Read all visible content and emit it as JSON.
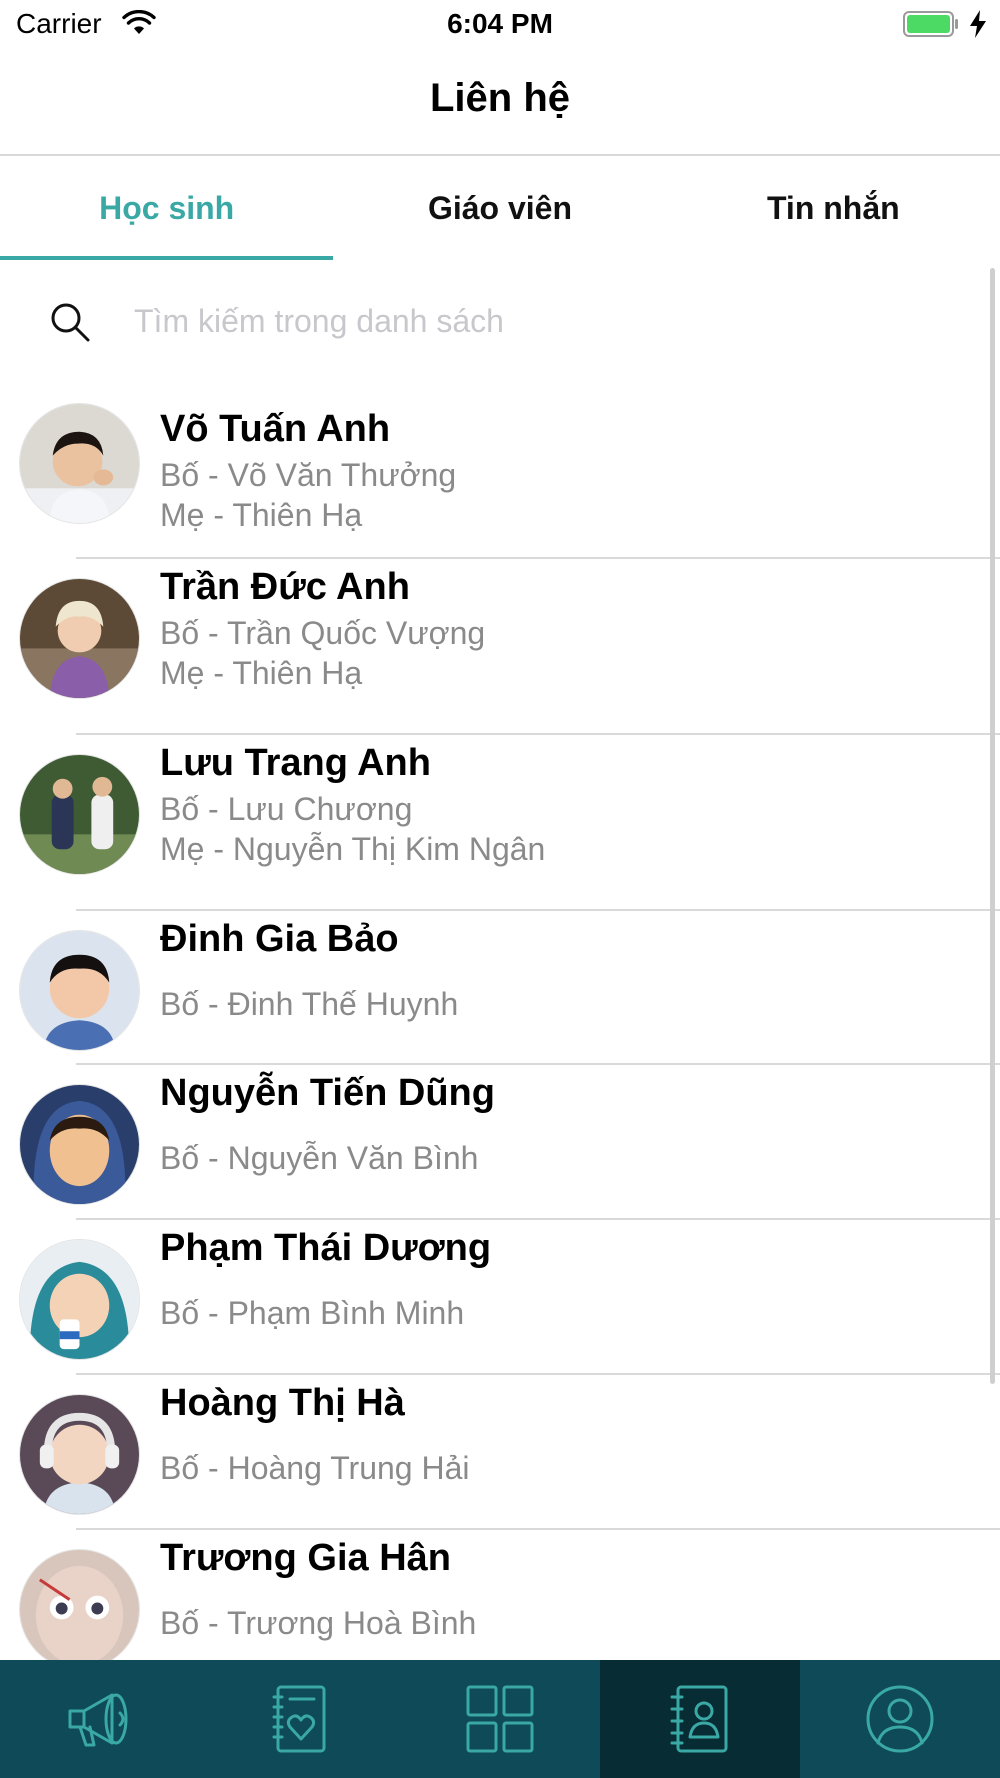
{
  "status_bar": {
    "carrier": "Carrier",
    "time": "6:04 PM"
  },
  "nav": {
    "title": "Liên hệ"
  },
  "tabs": [
    {
      "label": "Học sinh",
      "active": true
    },
    {
      "label": "Giáo viên",
      "active": false
    },
    {
      "label": "Tin nhắn",
      "active": false
    }
  ],
  "search": {
    "placeholder": "Tìm kiếm trong danh sách",
    "value": ""
  },
  "contacts": [
    {
      "name": "Võ Tuấn Anh",
      "parents": [
        "Bố - Võ Văn Thưởng",
        "Mẹ - Thiên Hạ"
      ]
    },
    {
      "name": "Trần Đức Anh",
      "parents": [
        "Bố - Trần Quốc Vượng",
        "Mẹ - Thiên Hạ"
      ]
    },
    {
      "name": "Lưu Trang Anh",
      "parents": [
        "Bố - Lưu Chương",
        "Mẹ - Nguyễn Thị Kim Ngân"
      ]
    },
    {
      "name": "Đinh Gia Bảo",
      "parents": [
        "Bố - Đinh Thế Huynh"
      ]
    },
    {
      "name": "Nguyễn Tiến Dũng",
      "parents": [
        "Bố - Nguyễn Văn Bình"
      ]
    },
    {
      "name": "Phạm Thái Dương",
      "parents": [
        "Bố - Phạm Bình Minh"
      ]
    },
    {
      "name": "Hoàng Thị Hà",
      "parents": [
        "Bố - Hoàng Trung Hải"
      ]
    },
    {
      "name": "Trương Gia Hân",
      "parents": [
        "Bố - Trương Hoà Bình"
      ]
    }
  ],
  "bottom_tabs": [
    {
      "icon": "megaphone-icon",
      "selected": false
    },
    {
      "icon": "notebook-heart-icon",
      "selected": false
    },
    {
      "icon": "grid-icon",
      "selected": false
    },
    {
      "icon": "contacts-book-icon",
      "selected": true
    },
    {
      "icon": "profile-icon",
      "selected": false
    }
  ],
  "colors": {
    "accent": "#3aa8a5",
    "tab_bar": "#0f4a58",
    "tab_bar_selected": "#082c34",
    "secondary_text": "#8a8a8a",
    "battery": "#4cd964"
  }
}
